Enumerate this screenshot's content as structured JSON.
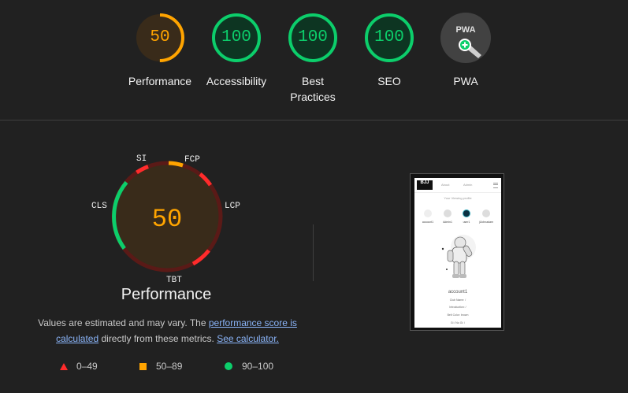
{
  "colors": {
    "pass": "#0cce6b",
    "average": "#ffa400",
    "fail": "#ff4e42",
    "pwa": "#5f6368"
  },
  "categories": [
    {
      "label": "Performance",
      "score": "50",
      "fraction": 0.5,
      "status": "average"
    },
    {
      "label": "Accessibility",
      "score": "100",
      "fraction": 1.0,
      "status": "pass"
    },
    {
      "label": "Best Practices",
      "score": "100",
      "fraction": 1.0,
      "status": "pass"
    },
    {
      "label": "SEO",
      "score": "100",
      "fraction": 1.0,
      "status": "pass"
    },
    {
      "label": "PWA",
      "badge": "PWA",
      "icon": "pwa-plus-icon"
    }
  ],
  "performance": {
    "score": "50",
    "title": "Performance",
    "metrics": [
      "SI",
      "FCP",
      "LCP",
      "TBT",
      "CLS"
    ],
    "description_prefix": "Values are estimated and may vary. The ",
    "link_score": "performance score is calculated",
    "description_middle": " directly from these metrics. ",
    "link_calculator": "See calculator."
  },
  "legend": [
    {
      "shape": "triangle",
      "range": "0–49"
    },
    {
      "shape": "square",
      "range": "50–89"
    },
    {
      "shape": "circle",
      "range": "90–100"
    }
  ],
  "screenshot": {
    "logo": "BJJ",
    "nav_about": "About",
    "nav_admin": "Admin",
    "subtitle": "Your Viewing profile",
    "accounts": [
      "account1",
      "Admin1",
      "user1",
      "jiJohnadam"
    ],
    "name": "account1",
    "rows": [
      "Club Name: /",
      "Introduction: /",
      "Belt Color: brown",
      "Gi / No Gi: /"
    ]
  }
}
